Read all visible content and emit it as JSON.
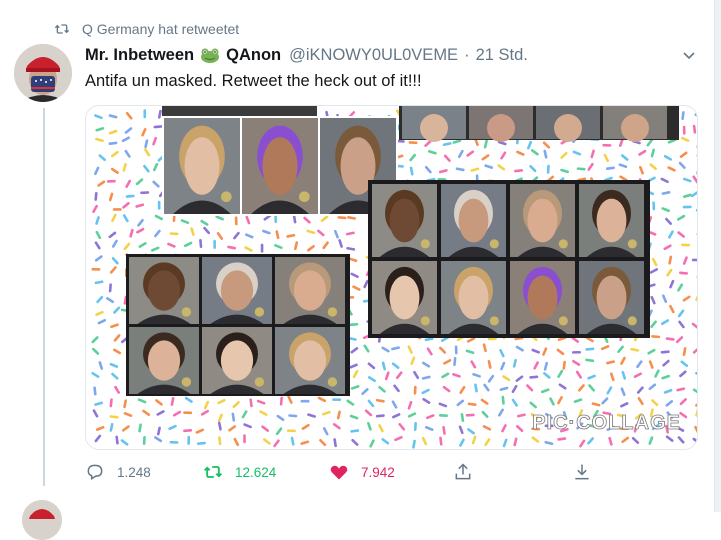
{
  "retweet_notice": {
    "text": "Q Germany hat retweetet"
  },
  "tweet": {
    "display_name": "Mr. Inbetween",
    "name_suffix": "QAnon",
    "handle": "@iKNOWY0UL0VEME",
    "separator": "·",
    "time": "21 Std.",
    "text": "Antifa un masked. Retweet the heck out of it!!!",
    "media": {
      "watermark": "PIC·COLLAGE",
      "sprinkle_colors": [
        "#f46fb0",
        "#66c3f0",
        "#f3d24a",
        "#8d74d6",
        "#5dd09a",
        "#f58f4d",
        "#7ea7ee"
      ],
      "photo_count": 26
    },
    "actions": {
      "replies": "1.248",
      "retweets": "12.624",
      "likes": "7.942"
    }
  },
  "colors": {
    "retweet_green": "#17bf63",
    "like_red": "#e0245e",
    "secondary_text": "#657786"
  }
}
